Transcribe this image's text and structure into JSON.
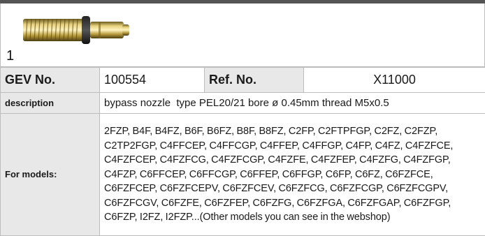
{
  "image": {
    "number": "1",
    "icon": "nozzle-photo"
  },
  "spec": {
    "gev_label": "GEV No.",
    "gev_value": "100554",
    "ref_label": "Ref. No.",
    "ref_value": "X11000",
    "description_label": "description",
    "description_value": "bypass nozzle  type PEL20/21 bore ø 0.45mm thread M5x0.5",
    "models_label": "For models:",
    "models_value": "2FZP, B4F, B4FZ, B6F, B6FZ, B8F, B8FZ, C2FP, C2FTPFGP, C2FZ, C2FZP, C2TP2FGP, C4FFCEP, C4FFCGP, C4FFEP, C4FFGP, C4FP, C4FZ, C4FZFCE, C4FZFCEP, C4FZFCG, C4FZFCGP, C4FZFE, C4FZFEP, C4FZFG, C4FZFGP, C4FZP, C6FFCEP, C6FFCGP, C6FFEP, C6FFGP, C6FP, C6FZ, C6FZFCE, C6FZFCEP, C6FZFCEPV, C6FZFCEV, C6FZFCG, C6FZFCGP, C6FZFCGPV, C6FZFCGV, C6FZFE, C6FZFEP, C6FZFG, C6FZFGA, C6FZFGAP, C6FZFGP, C6FZP, I2FZ, I2FZP...(Other models you can see in the webshop)"
  },
  "colors": {
    "header_bar": "#555555",
    "label_bg": "#e8e8e8",
    "border": "#bdbdbd"
  }
}
